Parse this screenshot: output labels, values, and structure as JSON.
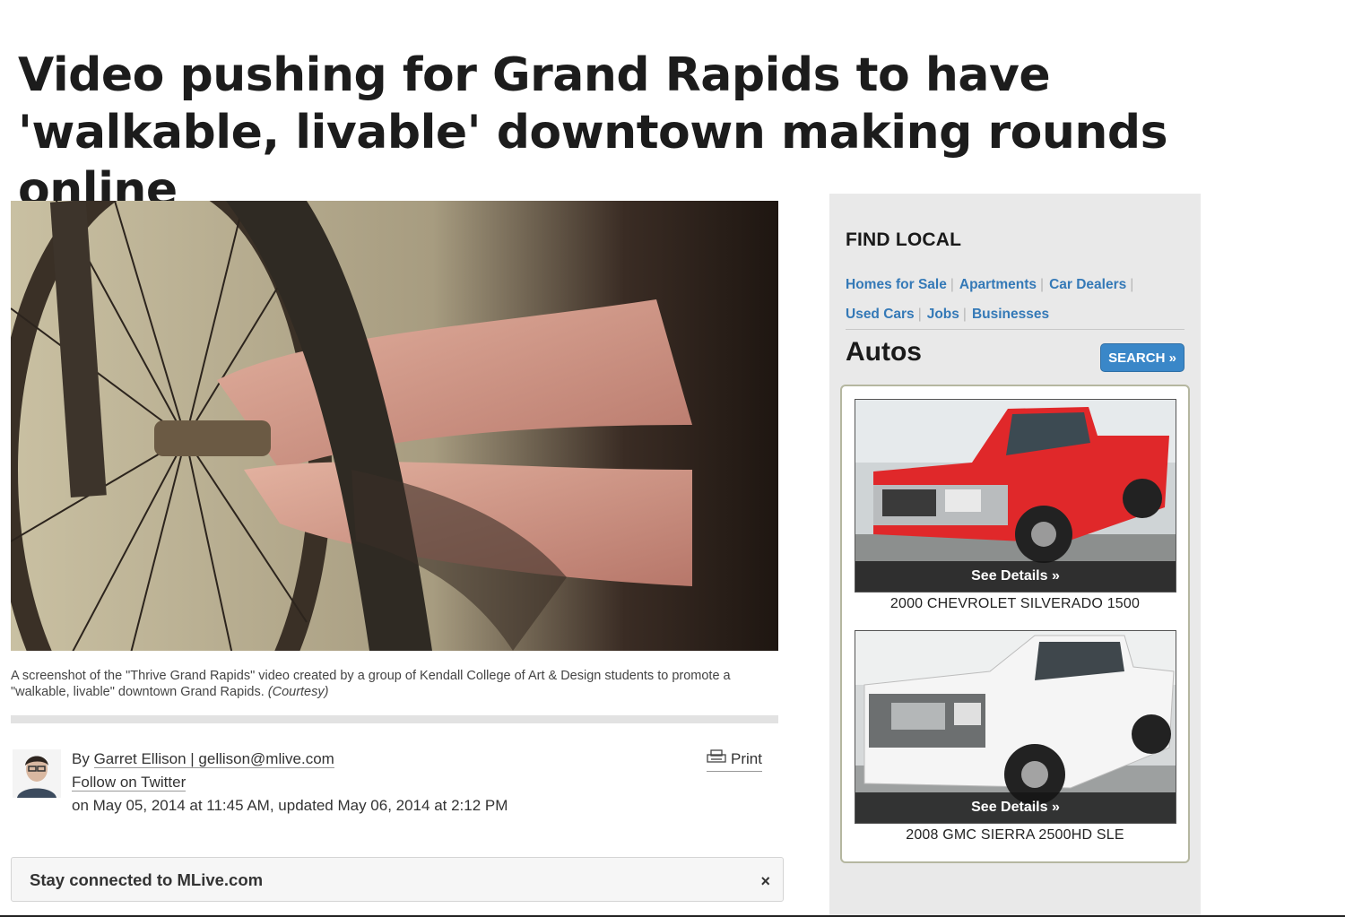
{
  "article": {
    "headline": "Video pushing for Grand Rapids to have 'walkable, livable' downtown making rounds online",
    "caption": "A screenshot of the \"Thrive Grand Rapids\" video created by a group of Kendall College of Art & Design students to promote a \"walkable, livable\" downtown Grand Rapids.",
    "caption_credit": "(Courtesy)"
  },
  "byline": {
    "by_prefix": "By ",
    "author_link": "Garret Ellison | gellison@mlive.com",
    "twitter_link": "Follow on Twitter",
    "date_line": "on May 05, 2014 at 11:45 AM, updated May 06, 2014 at 2:12 PM",
    "print_label": "Print"
  },
  "stay_connected": {
    "label": "Stay connected to MLive.com",
    "close_symbol": "×"
  },
  "sidebar": {
    "find_local_title": "FIND LOCAL",
    "links": [
      "Homes for Sale",
      "Apartments",
      "Car Dealers",
      "Used Cars",
      "Jobs",
      "Businesses"
    ],
    "separator": "|",
    "autos_title": "Autos",
    "search_label": "SEARCH »",
    "link_color": "#3479b7",
    "cars": [
      {
        "name": "2000 CHEVROLET SILVERADO 1500",
        "details_label": "See Details »",
        "color": "red"
      },
      {
        "name": "2008 GMC SIERRA 2500HD SLE",
        "details_label": "See Details »",
        "color": "white"
      }
    ]
  },
  "icons": {
    "print": "printer-icon",
    "close": "close-icon"
  }
}
